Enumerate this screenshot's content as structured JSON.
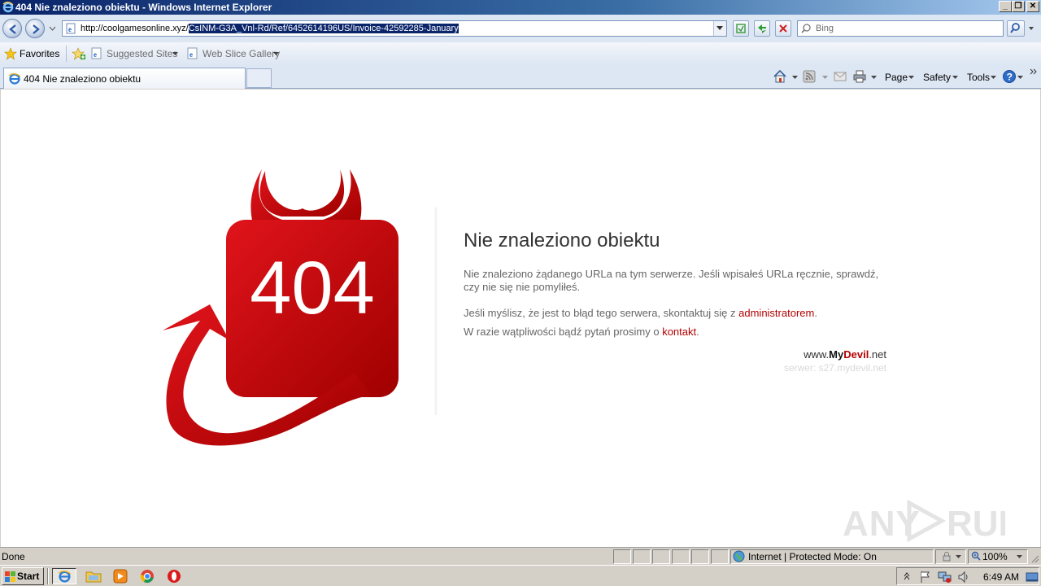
{
  "window": {
    "title": "404 Nie znaleziono obiektu - Windows Internet Explorer",
    "controls": {
      "minimize": "_",
      "restore": "❐",
      "close": "✕"
    }
  },
  "address_bar": {
    "url_prefix": "http://coolgamesonline.xyz/",
    "url_selected": "CsINM-G3A_Vnl-Rd/Ref/6452614196US/Invoice-42592285-January"
  },
  "search": {
    "placeholder": "Bing"
  },
  "favorites_bar": {
    "favorites": "Favorites",
    "suggested_sites": "Suggested Sites",
    "web_slice_gallery": "Web Slice Gallery"
  },
  "tabs": [
    {
      "label": "404 Nie znaleziono obiektu"
    }
  ],
  "command_bar": {
    "page": "Page",
    "safety": "Safety",
    "tools": "Tools"
  },
  "page": {
    "error_code": "404",
    "heading": "Nie znaleziono obiektu",
    "para1": "Nie znaleziono żądanego URLa na tym serwerze. Jeśli wpisałeś URLa ręcznie, sprawdź, czy nie się nie pomyliłeś.",
    "para2_text": "Jeśli myślisz, że jest to błąd tego serwera, skontaktuj się z ",
    "para2_link": "administratorem",
    "para2_end": ".",
    "para3_text": "W razie wątpliwości bądź pytań prosimy o ",
    "para3_link": "kontakt",
    "para3_end": ".",
    "brand_prefix": "www.",
    "brand_my": "My",
    "brand_devil": "Devil",
    "brand_suffix": ".net",
    "server": "serwer: s27.mydevil.net",
    "watermark": "ANY RUN",
    "accent_color": "#b40000"
  },
  "status_bar": {
    "status": "Done",
    "zone": "Internet | Protected Mode: On",
    "zoom": "100%"
  },
  "taskbar": {
    "start": "Start",
    "clock": "6:49 AM"
  }
}
